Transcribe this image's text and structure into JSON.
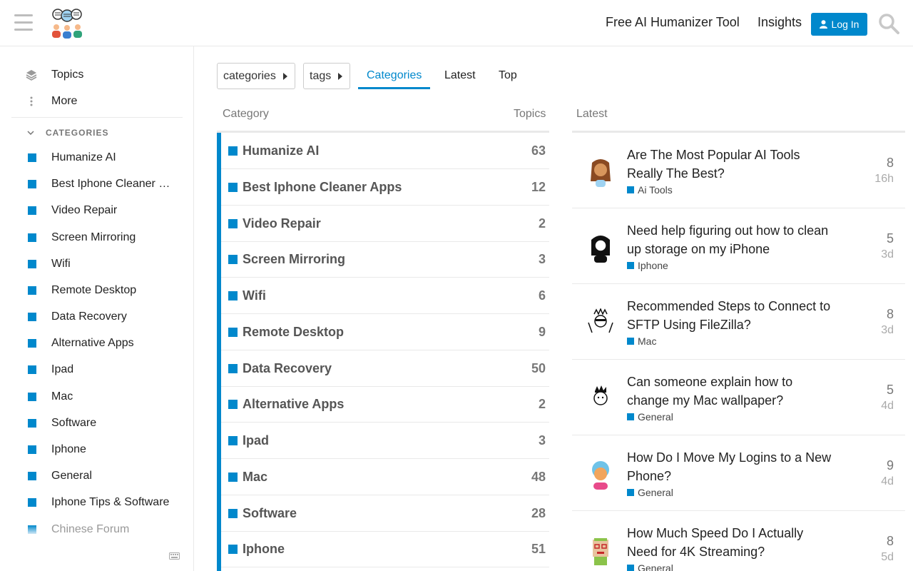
{
  "header": {
    "links": [
      "Free AI Humanizer Tool",
      "Insights"
    ],
    "login_label": "Log In"
  },
  "sidebar": {
    "items": [
      {
        "label": "Topics",
        "icon": "layers-icon"
      },
      {
        "label": "More",
        "icon": "vertical-ellipsis-icon"
      }
    ],
    "categories_heading": "CATEGORIES",
    "categories": [
      "Humanize AI",
      "Best Iphone Cleaner …",
      "Video Repair",
      "Screen Mirroring",
      "Wifi",
      "Remote Desktop",
      "Data Recovery",
      "Alternative Apps",
      "Ipad",
      "Mac",
      "Software",
      "Iphone",
      "General",
      "Iphone Tips & Software",
      "Chinese Forum"
    ]
  },
  "nav": {
    "pills": [
      "categories",
      "tags"
    ],
    "tabs": [
      "Categories",
      "Latest",
      "Top"
    ],
    "active_tab": "Categories"
  },
  "table": {
    "col_category": "Category",
    "col_topics": "Topics",
    "rows": [
      {
        "name": "Humanize AI",
        "count": "63"
      },
      {
        "name": "Best Iphone Cleaner Apps",
        "count": "12"
      },
      {
        "name": "Video Repair",
        "count": "2"
      },
      {
        "name": "Screen Mirroring",
        "count": "3"
      },
      {
        "name": "Wifi",
        "count": "6"
      },
      {
        "name": "Remote Desktop",
        "count": "9"
      },
      {
        "name": "Data Recovery",
        "count": "50"
      },
      {
        "name": "Alternative Apps",
        "count": "2"
      },
      {
        "name": "Ipad",
        "count": "3"
      },
      {
        "name": "Mac",
        "count": "48"
      },
      {
        "name": "Software",
        "count": "28"
      },
      {
        "name": "Iphone",
        "count": "51"
      }
    ]
  },
  "latest": {
    "heading": "Latest",
    "topics": [
      {
        "title": "Are The Most Popular AI Tools Really The Best?",
        "category": "Ai Tools",
        "replies": "8",
        "age": "16h"
      },
      {
        "title": "Need help figuring out how to clean up storage on my iPhone",
        "category": "Iphone",
        "replies": "5",
        "age": "3d"
      },
      {
        "title": "Recommended Steps to Connect to SFTP Using FileZilla?",
        "category": "Mac",
        "replies": "8",
        "age": "3d"
      },
      {
        "title": "Can someone explain how to change my Mac wallpaper?",
        "category": "General",
        "replies": "5",
        "age": "4d"
      },
      {
        "title": "How Do I Move My Logins to a New Phone?",
        "category": "General",
        "replies": "9",
        "age": "4d"
      },
      {
        "title": "How Much Speed Do I Actually Need for 4K Streaming?",
        "category": "General",
        "replies": "8",
        "age": "5d"
      }
    ]
  },
  "colors": {
    "accent": "#0088cc",
    "border": "#e9e9e9",
    "muted": "#777777"
  }
}
